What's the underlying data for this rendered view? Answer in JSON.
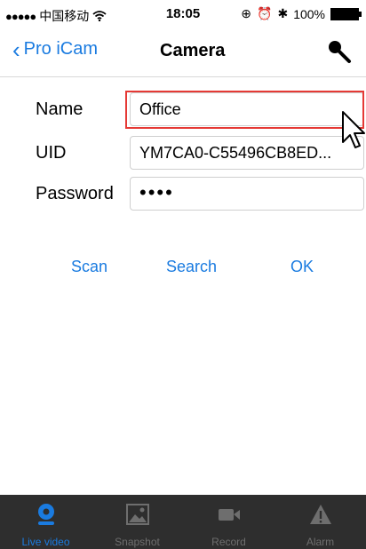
{
  "status": {
    "carrier": "中国移动",
    "time": "18:05",
    "battery": "100%"
  },
  "nav": {
    "back_label": "Pro iCam",
    "title": "Camera"
  },
  "form": {
    "name_label": "Name",
    "name_value": "Office",
    "uid_label": "UID",
    "uid_value": "YM7CA0-C55496CB8ED...",
    "password_label": "Password",
    "password_value": "••••"
  },
  "actions": {
    "scan": "Scan",
    "search": "Search",
    "ok": "OK"
  },
  "tabs": [
    {
      "label": "Live video",
      "icon": "webcam-icon",
      "active": true
    },
    {
      "label": "Snapshot",
      "icon": "image-icon",
      "active": false
    },
    {
      "label": "Record",
      "icon": "video-camera-icon",
      "active": false
    },
    {
      "label": "Alarm",
      "icon": "warning-icon",
      "active": false
    }
  ],
  "colors": {
    "accent": "#1a7be0",
    "tabbar": "#2e2e2e",
    "highlight": "#e53935"
  }
}
